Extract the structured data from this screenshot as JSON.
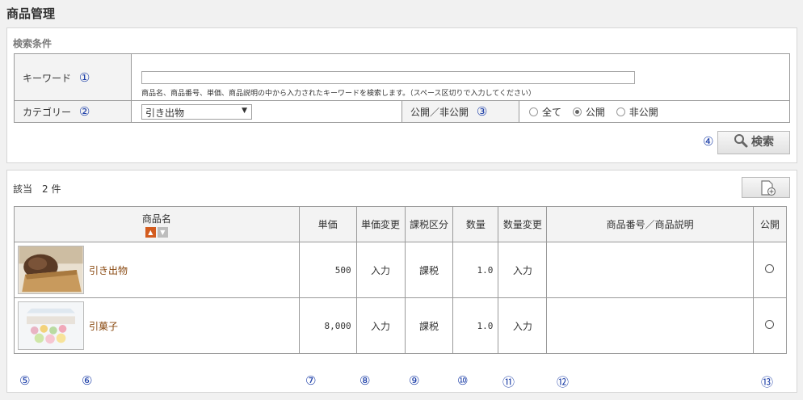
{
  "page": {
    "title": "商品管理"
  },
  "search": {
    "section_label": "検索条件",
    "keyword_label": "キーワード",
    "keyword_value": "",
    "keyword_help": "商品名、商品番号、単価、商品説明の中から入力されたキーワードを検索します。（スペース区切りで入力してください）",
    "category_label": "カテゴリー",
    "category_value": "引き出物",
    "visibility_label": "公開／非公開",
    "visibility_options": [
      "全て",
      "公開",
      "非公開"
    ],
    "visibility_selected": "公開",
    "search_button": "検索"
  },
  "results": {
    "count_text": "該当　2 件",
    "columns": [
      "商品名",
      "単価",
      "単価変更",
      "課税区分",
      "数量",
      "数量変更",
      "商品番号／商品説明",
      "公開"
    ],
    "rows": [
      {
        "name": "引き出物",
        "price": "500",
        "price_change": "入力",
        "tax": "課税",
        "qty": "1.0",
        "qty_change": "入力",
        "code_desc": "",
        "public": "○"
      },
      {
        "name": "引菓子",
        "price": "8,000",
        "price_change": "入力",
        "tax": "課税",
        "qty": "1.0",
        "qty_change": "入力",
        "code_desc": "",
        "public": "○"
      }
    ]
  },
  "annotations": [
    "①",
    "②",
    "③",
    "④",
    "⑤",
    "⑥",
    "⑦",
    "⑧",
    "⑨",
    "⑩",
    "⑪",
    "⑫",
    "⑬"
  ],
  "icons": {
    "search": "search-icon",
    "add": "add-document-icon",
    "sort_asc": "sort-asc-icon",
    "sort_desc": "sort-desc-icon"
  },
  "colors": {
    "annotation": "#1d3fa8",
    "link": "#8a4a12",
    "sort_active": "#d35c1f"
  }
}
